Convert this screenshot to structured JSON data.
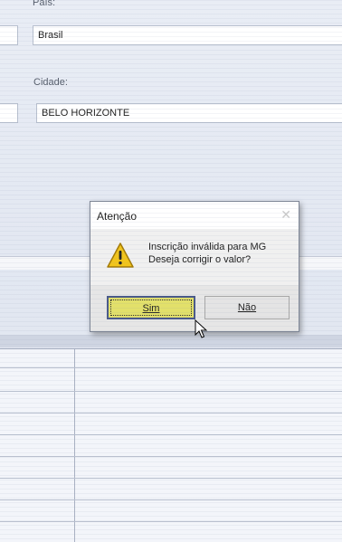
{
  "form": {
    "pais_label": "País:",
    "pais_value": "Brasil",
    "cidade_label": "Cidade:",
    "cidade_value": "BELO HORIZONTE"
  },
  "dialog": {
    "title": "Atenção",
    "close_glyph": "✕",
    "message_line1": "Inscrição inválida para MG",
    "message_line2": "Deseja corrigir o valor?",
    "icon": "warning-icon",
    "yes_label": "Sim",
    "no_label": "Não"
  },
  "colors": {
    "yes_button": "#e2e06a",
    "warning": "#f2c51b"
  }
}
